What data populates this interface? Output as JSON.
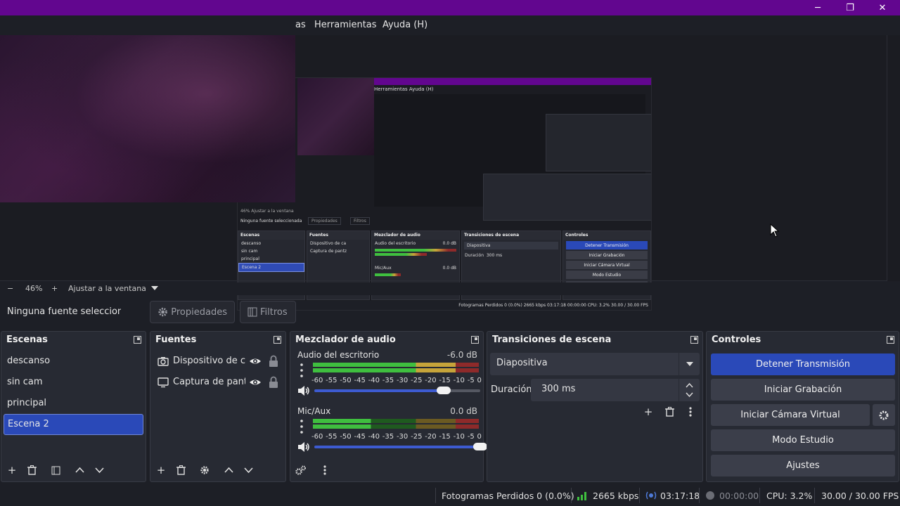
{
  "window": {
    "minimize": "─",
    "maximize": "❐",
    "close": "✕"
  },
  "menu": {
    "partial": "as",
    "tools": "Herramientas",
    "help": "Ayuda (H)"
  },
  "nested_preview": {
    "menu": "Herramientas    Ayuda (H)",
    "no_source": "Ninguna fuente seleccionada",
    "props": "Propiedades",
    "filters": "Filtros",
    "zoom": "46%    Ajustar a la ventana",
    "scenes_title": "Escenas",
    "scenes": [
      "descanso",
      "sin cam",
      "principal",
      "Escena 2"
    ],
    "sources_title": "Fuentes",
    "sources": [
      "Dispositivo de ca",
      "Captura de pantz"
    ],
    "mixer_title": "Mezclador de audio",
    "ch1": "Audio del escritorio",
    "ch1_db": "0.0 dB",
    "ch2": "Mic/Aux",
    "ch2_db": "0.0 dB",
    "trans_title": "Transiciones de escena",
    "trans_value": "Diapositiva",
    "dur_label": "Duración",
    "dur_value": "300 ms",
    "controls_title": "Controles",
    "controls": [
      "Detener Transmisión",
      "Iniciar Grabación",
      "Iniciar Cámara Virtual",
      "Modo Estudio",
      "Ajustes"
    ],
    "status": "Fotogramas Perdidos 0 (0.0%)    2665 kbps    03:17:18    00:00:00    CPU: 3.2%    30.00 / 30.00 FPS"
  },
  "zoom": {
    "minus": "−",
    "level": "46%",
    "plus": "+",
    "fit": "Ajustar a la ventana"
  },
  "source_toolbar": {
    "no_source": "Ninguna fuente seleccionada",
    "properties": "Propiedades",
    "filters": "Filtros"
  },
  "scenes": {
    "title": "Escenas",
    "items": [
      "descanso",
      "sin cam",
      "principal",
      "Escena 2"
    ],
    "selected": "Escena 2"
  },
  "sources": {
    "title": "Fuentes",
    "items": [
      {
        "label": "Dispositivo de captura de video",
        "icon": "camera-icon"
      },
      {
        "label": "Captura de pantalla",
        "icon": "monitor-icon"
      }
    ]
  },
  "mixer": {
    "title": "Mezclador de audio",
    "channels": [
      {
        "name": "Audio del escritorio",
        "db": "-6.0 dB",
        "level": 0.78,
        "volume": 0.78
      },
      {
        "name": "Mic/Aux",
        "db": "0.0 dB",
        "level": 0.35,
        "volume": 1.0
      }
    ],
    "ticks": [
      "-60",
      "-55",
      "-50",
      "-45",
      "-40",
      "-35",
      "-30",
      "-25",
      "-20",
      "-15",
      "-10",
      "-5",
      "0"
    ]
  },
  "transitions": {
    "title": "Transiciones de escena",
    "selected": "Diapositiva",
    "duration_label": "Duración",
    "duration_value": "300 ms"
  },
  "controls": {
    "title": "Controles",
    "stop_stream": "Detener Transmisión",
    "start_recording": "Iniciar Grabación",
    "start_virtual_cam": "Iniciar Cámara Virtual",
    "studio_mode": "Modo Estudio",
    "settings": "Ajustes"
  },
  "status": {
    "dropped_frames": "Fotogramas Perdidos 0 (0.0%)",
    "bitrate": "2665 kbps",
    "stream_time": "03:17:18",
    "record_time": "00:00:00",
    "cpu": "CPU: 3.2%",
    "fps": "30.00 / 30.00 FPS"
  },
  "colors": {
    "titlebar": "#62068f",
    "accent_blue": "#2a49b8",
    "meter_green": "#3fbf3f",
    "meter_yellow": "#c6a43a",
    "meter_red": "#8e2a2a"
  }
}
